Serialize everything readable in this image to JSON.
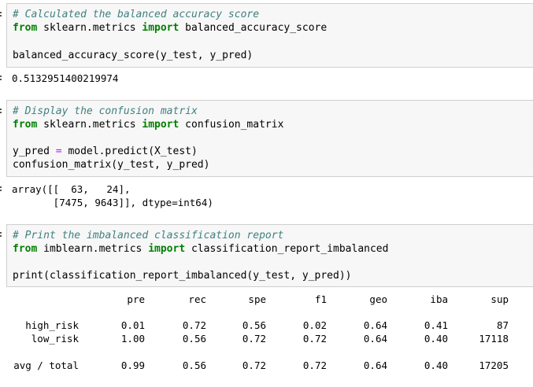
{
  "cell1": {
    "comment": "# Calculated the balanced accuracy score",
    "import_from": "from",
    "import_module": " sklearn.metrics ",
    "import_kw": "import",
    "import_name": " balanced_accuracy_score",
    "call": "balanced_accuracy_score(y_test, y_pred)",
    "output": "0.5132951400219974"
  },
  "cell2": {
    "comment": "# Display the confusion matrix",
    "import_from": "from",
    "import_module": " sklearn.metrics ",
    "import_kw": "import",
    "import_name": " confusion_matrix",
    "assign_lhs": "y_pred ",
    "assign_op": "=",
    "assign_rhs": " model.predict(X_test)",
    "call": "confusion_matrix(y_test, y_pred)",
    "output_line1": "array([[  63,   24],",
    "output_line2": "       [7475, 9643]], dtype=int64)"
  },
  "cell3": {
    "comment": "# Print the imbalanced classification report",
    "import_from": "from",
    "import_module": " imblearn.metrics ",
    "import_kw": "import",
    "import_name": " classification_report_imbalanced",
    "call": "print(classification_report_imbalanced(y_test, y_pred))"
  },
  "report": {
    "headers": [
      "pre",
      "rec",
      "spe",
      "f1",
      "geo",
      "iba",
      "sup"
    ],
    "rows": [
      {
        "label": "high_risk",
        "values": [
          "0.01",
          "0.72",
          "0.56",
          "0.02",
          "0.64",
          "0.41",
          "87"
        ]
      },
      {
        "label": "low_risk",
        "values": [
          "1.00",
          "0.56",
          "0.72",
          "0.72",
          "0.64",
          "0.40",
          "17118"
        ]
      },
      {
        "label": "avg / total",
        "values": [
          "0.99",
          "0.56",
          "0.72",
          "0.72",
          "0.64",
          "0.40",
          "17205"
        ]
      }
    ]
  }
}
